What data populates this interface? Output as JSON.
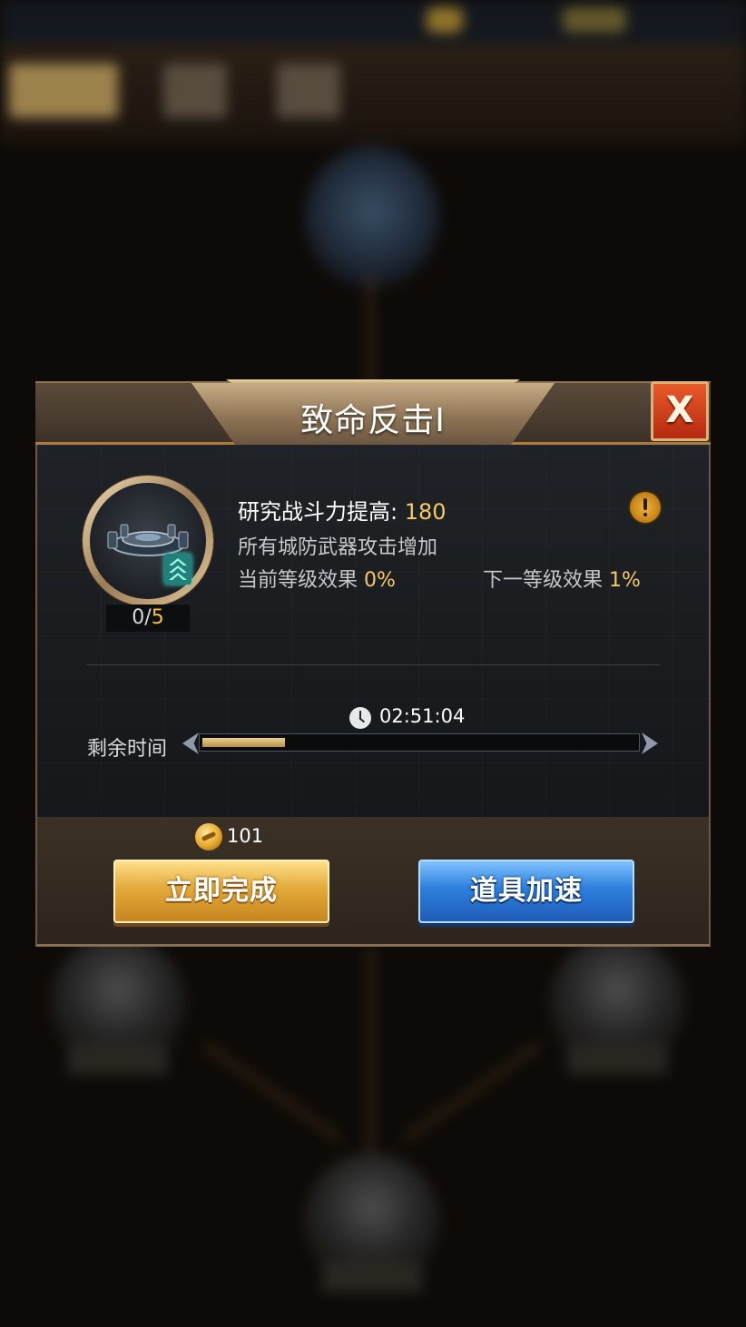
{
  "dialog": {
    "title": "致命反击I",
    "close_label": "X"
  },
  "research": {
    "level_current": "0",
    "level_separator": "/",
    "level_max": "5",
    "power_label": "研究战斗力提高:",
    "power_value": "180",
    "description": "所有城防武器攻击增加",
    "current_effect_label": "当前等级效果",
    "current_effect_value": "0%",
    "next_effect_label": "下一等级效果",
    "next_effect_value": "1%"
  },
  "timer": {
    "countdown": "02:51:04",
    "remaining_label": "剩余时间",
    "progress": 0.19
  },
  "footer": {
    "gold_cost": "101",
    "complete_button": "立即完成",
    "speedup_button": "道具加速"
  },
  "colors": {
    "accent_gold": "#f3c96a",
    "button_gold": "#e3a93a",
    "button_blue": "#2d7fdc",
    "close_red": "#c83a18"
  },
  "icons": {
    "info": "exclamation-info-icon",
    "clock": "clock-icon",
    "coin": "gold-coin-icon",
    "rank": "chevron-rank-icon"
  }
}
